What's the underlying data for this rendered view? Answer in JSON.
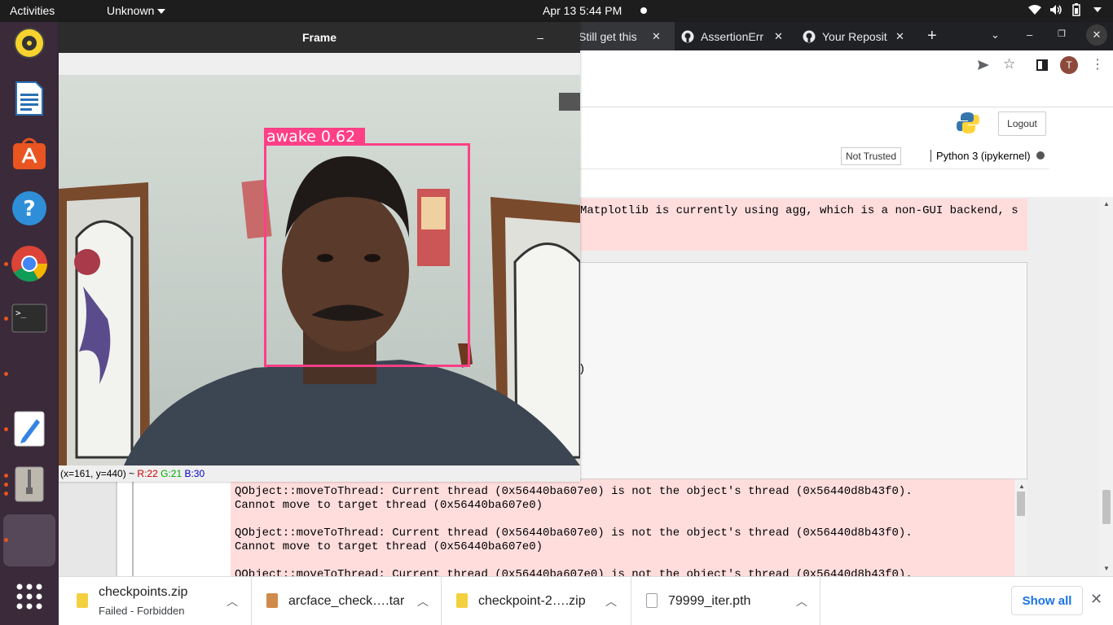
{
  "topbar": {
    "activities": "Activities",
    "app_menu": "Unknown",
    "clock": "Apr 13  5:44 PM"
  },
  "dock": {
    "apps": [
      "rhythmbox-icon",
      "writer-icon",
      "software-center-icon",
      "help-icon",
      "chrome-icon",
      "terminal-icon",
      "text-editor-icon",
      "archive-icon",
      "active-window-icon",
      "app-grid-icon"
    ]
  },
  "browser": {
    "tabs": [
      {
        "title": "Still get this",
        "icon": "error-tab-icon"
      },
      {
        "title": "AssertionErr",
        "icon": "github-icon"
      },
      {
        "title": "Your Reposit",
        "icon": "github-icon"
      }
    ],
    "new_tab": "+",
    "profile_initial": "T"
  },
  "jupyter": {
    "logout": "Logout",
    "not_trusted": "Not Trusted",
    "kernel": "Python 3 (ipykernel)",
    "warning_output": "Matplotlib is currently using agg, which is a non-GUI backend, s",
    "cell_fragment": ")",
    "qobject_output": "QObject::moveToThread: Current thread (0x56440ba607e0) is not the object's thread (0x56440d8b43f0).\nCannot move to target thread (0x56440ba607e0)\n\nQObject::moveToThread: Current thread (0x56440ba607e0) is not the object's thread (0x56440d8b43f0).\nCannot move to target thread (0x56440ba607e0)\n\nQObject::moveToThread: Current thread (0x56440ba607e0) is not the object's thread (0x56440d8b43f0)."
  },
  "frame_window": {
    "title": "Frame",
    "detection_label": "awake 0.62",
    "detection_color": "#ff3f86",
    "status": {
      "coords": "(x=161, y=440) ~",
      "r": "R:22",
      "g": "G:21",
      "b": "B:30"
    }
  },
  "downloads": {
    "items": [
      {
        "name": "checkpoints.zip",
        "status": "Failed - Forbidden",
        "icon_color": "#f4d03f"
      },
      {
        "name": "arcface_check….tar",
        "status": "",
        "icon_color": "#d08a4a"
      },
      {
        "name": "checkpoint-2….zip",
        "status": "",
        "icon_color": "#f4d03f"
      },
      {
        "name": "79999_iter.pth",
        "status": "",
        "icon_color": "#9aa0a6"
      }
    ],
    "show_all": "Show all"
  }
}
